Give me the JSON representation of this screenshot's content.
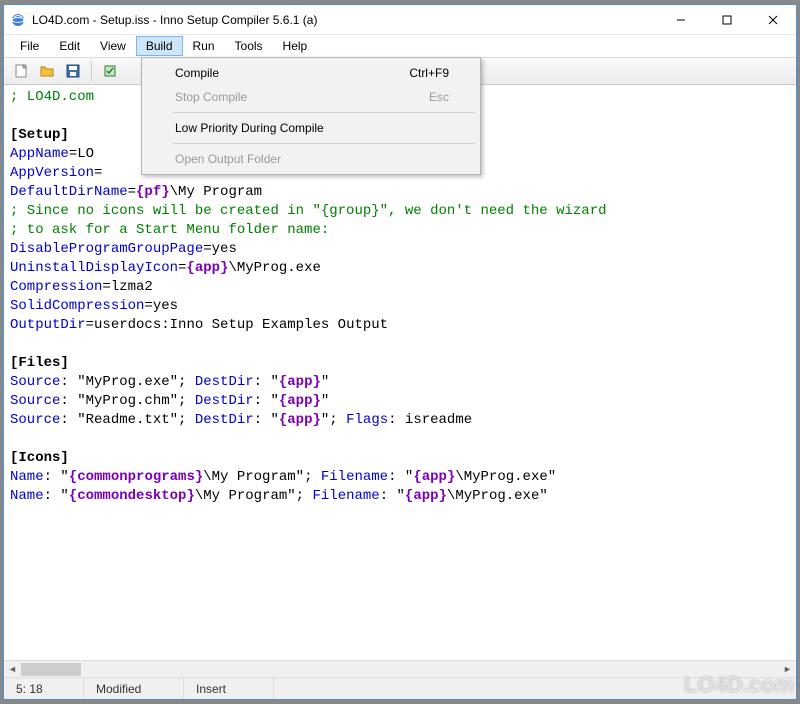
{
  "window": {
    "title": "LO4D.com - Setup.iss - Inno Setup Compiler 5.6.1 (a)"
  },
  "menubar": {
    "items": [
      "File",
      "Edit",
      "View",
      "Build",
      "Run",
      "Tools",
      "Help"
    ],
    "active_index": 3
  },
  "toolbar": {
    "icons": [
      "new-file-icon",
      "open-file-icon",
      "save-icon",
      "compile-icon"
    ]
  },
  "dropdown": {
    "items": [
      {
        "label": "Compile",
        "shortcut": "Ctrl+F9",
        "enabled": true
      },
      {
        "label": "Stop Compile",
        "shortcut": "Esc",
        "enabled": false
      },
      {
        "sep": true
      },
      {
        "label": "Low Priority During Compile",
        "shortcut": "",
        "enabled": true
      },
      {
        "sep": true
      },
      {
        "label": "Open Output Folder",
        "shortcut": "",
        "enabled": false
      }
    ]
  },
  "editor": {
    "lines": [
      {
        "t": "comment",
        "text": "; LO4D.com"
      },
      {
        "t": "blank",
        "text": ""
      },
      {
        "t": "section",
        "text": "[Setup]"
      },
      {
        "t": "kv",
        "key": "AppName",
        "rest": "=LO"
      },
      {
        "t": "kv",
        "key": "AppVersion",
        "rest": "="
      },
      {
        "t": "kvconst",
        "key": "DefaultDirName",
        "eq": "=",
        "const": "{pf}",
        "tail": "\\My Program"
      },
      {
        "t": "comment",
        "text": "; Since no icons will be created in \"{group}\", we don't need the wizard"
      },
      {
        "t": "comment",
        "text": "; to ask for a Start Menu folder name:"
      },
      {
        "t": "kv",
        "key": "DisableProgramGroupPage",
        "rest": "=yes"
      },
      {
        "t": "kvconst",
        "key": "UninstallDisplayIcon",
        "eq": "=",
        "const": "{app}",
        "tail": "\\MyProg.exe"
      },
      {
        "t": "kv",
        "key": "Compression",
        "rest": "=lzma2"
      },
      {
        "t": "kv",
        "key": "SolidCompression",
        "rest": "=yes"
      },
      {
        "t": "kv",
        "key": "OutputDir",
        "rest": "=userdocs:Inno Setup Examples Output"
      },
      {
        "t": "blank",
        "text": ""
      },
      {
        "t": "section",
        "text": "[Files]"
      },
      {
        "t": "files",
        "p1": "Source",
        "v1": ": \"MyProg.exe\"; ",
        "p2": "DestDir",
        "v2": ": \"",
        "const": "{app}",
        "v3": "\""
      },
      {
        "t": "files",
        "p1": "Source",
        "v1": ": \"MyProg.chm\"; ",
        "p2": "DestDir",
        "v2": ": \"",
        "const": "{app}",
        "v3": "\""
      },
      {
        "t": "filesflags",
        "p1": "Source",
        "v1": ": \"Readme.txt\"; ",
        "p2": "DestDir",
        "v2": ": \"",
        "const": "{app}",
        "v3": "\"; ",
        "p3": "Flags",
        "v4": ": isreadme"
      },
      {
        "t": "blank",
        "text": ""
      },
      {
        "t": "section",
        "text": "[Icons]"
      },
      {
        "t": "icons",
        "p1": "Name",
        "v1": ": \"",
        "c1": "{commonprograms}",
        "v2": "\\My Program\"; ",
        "p2": "Filename",
        "v3": ": \"",
        "c2": "{app}",
        "v4": "\\MyProg.exe\""
      },
      {
        "t": "icons",
        "p1": "Name",
        "v1": ": \"",
        "c1": "{commondesktop}",
        "v2": "\\My Program\"; ",
        "p2": "Filename",
        "v3": ": \"",
        "c2": "{app}",
        "v4": "\\MyProg.exe\""
      }
    ]
  },
  "statusbar": {
    "pos": "5:  18",
    "modified": "Modified",
    "insert": "Insert"
  },
  "watermark": "LO4D.com"
}
